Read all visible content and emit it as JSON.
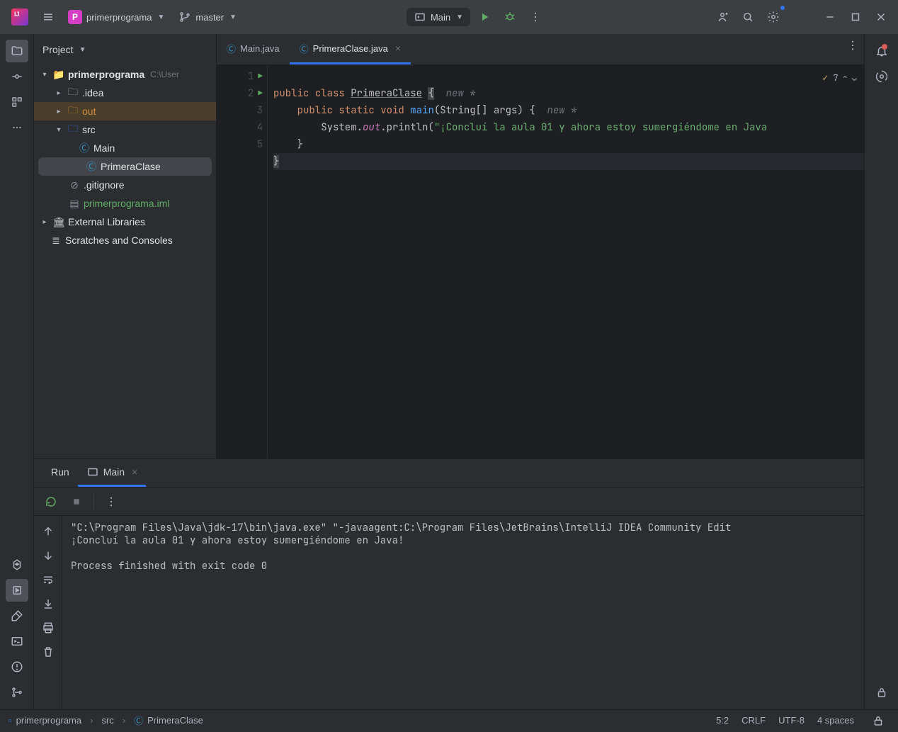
{
  "titlebar": {
    "project_name": "primerprograma",
    "branch": "master",
    "run_config": "Main"
  },
  "project_panel": {
    "title": "Project",
    "root": "primerprograma",
    "root_path": "C:\\User",
    "items": {
      "idea": ".idea",
      "out": "out",
      "src": "src",
      "main": "Main",
      "primera": "PrimeraClase",
      "gitignore": ".gitignore",
      "iml": "primerprograma.iml",
      "ext": "External Libraries",
      "scratch": "Scratches and Consoles"
    }
  },
  "editor": {
    "tabs": {
      "main": "Main.java",
      "primera": "PrimeraClase.java"
    },
    "inspect_count": "7",
    "code": {
      "l1_kw1": "public",
      "l1_kw2": "class",
      "l1_cls": "PrimeraClase",
      "l1_brace": "{",
      "l1_hint": "new *",
      "l2_kw1": "public",
      "l2_kw2": "static",
      "l2_kw3": "void",
      "l2_fn": "main",
      "l2_sig": "(String[] args) {",
      "l2_hint": "new *",
      "l3_a": "System.",
      "l3_out": "out",
      "l3_b": ".println(",
      "l3_str": "\"¡Concluí la aula 01 y ahora estoy sumergiéndome en Java",
      "l4": "}",
      "l5": "}"
    }
  },
  "run": {
    "label": "Run",
    "tab": "Main",
    "console_line1": "\"C:\\Program Files\\Java\\jdk-17\\bin\\java.exe\" \"-javaagent:C:\\Program Files\\JetBrains\\IntelliJ IDEA Community Edit",
    "console_line2": "¡Concluí la aula 01 y ahora estoy sumergiéndome en Java!",
    "console_line3": "Process finished with exit code 0"
  },
  "statusbar": {
    "crumb1": "primerprograma",
    "crumb2": "src",
    "crumb3": "PrimeraClase",
    "pos": "5:2",
    "line_sep": "CRLF",
    "encoding": "UTF-8",
    "indent": "4 spaces"
  }
}
